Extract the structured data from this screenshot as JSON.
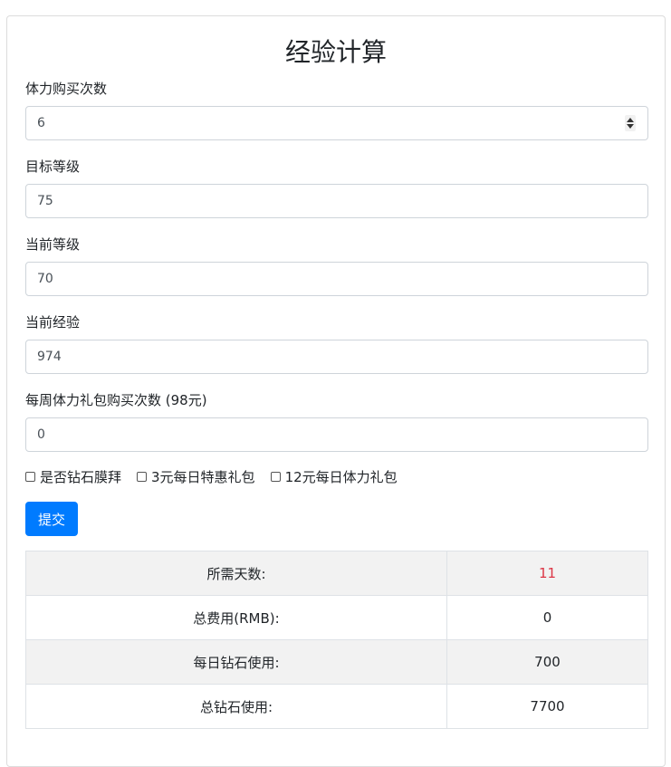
{
  "title": "经验计算",
  "form": {
    "fields": [
      {
        "label": "体力购买次数",
        "value": "6"
      },
      {
        "label": "目标等级",
        "value": "75"
      },
      {
        "label": "当前等级",
        "value": "70"
      },
      {
        "label": "当前经验",
        "value": "974"
      },
      {
        "label": "每周体力礼包购买次数 (98元)",
        "value": "0"
      }
    ],
    "checkboxes": [
      {
        "label": "是否钻石膜拜",
        "checked": false
      },
      {
        "label": "3元每日特惠礼包",
        "checked": false
      },
      {
        "label": "12元每日体力礼包",
        "checked": false
      }
    ],
    "submit_label": "提交"
  },
  "results": [
    {
      "label": "所需天数:",
      "value": "11"
    },
    {
      "label": "总费用(RMB):",
      "value": "0"
    },
    {
      "label": "每日钻石使用:",
      "value": "700"
    },
    {
      "label": "总钻石使用:",
      "value": "7700"
    }
  ],
  "colors": {
    "primary": "#007bff",
    "highlight": "#dc3545"
  }
}
